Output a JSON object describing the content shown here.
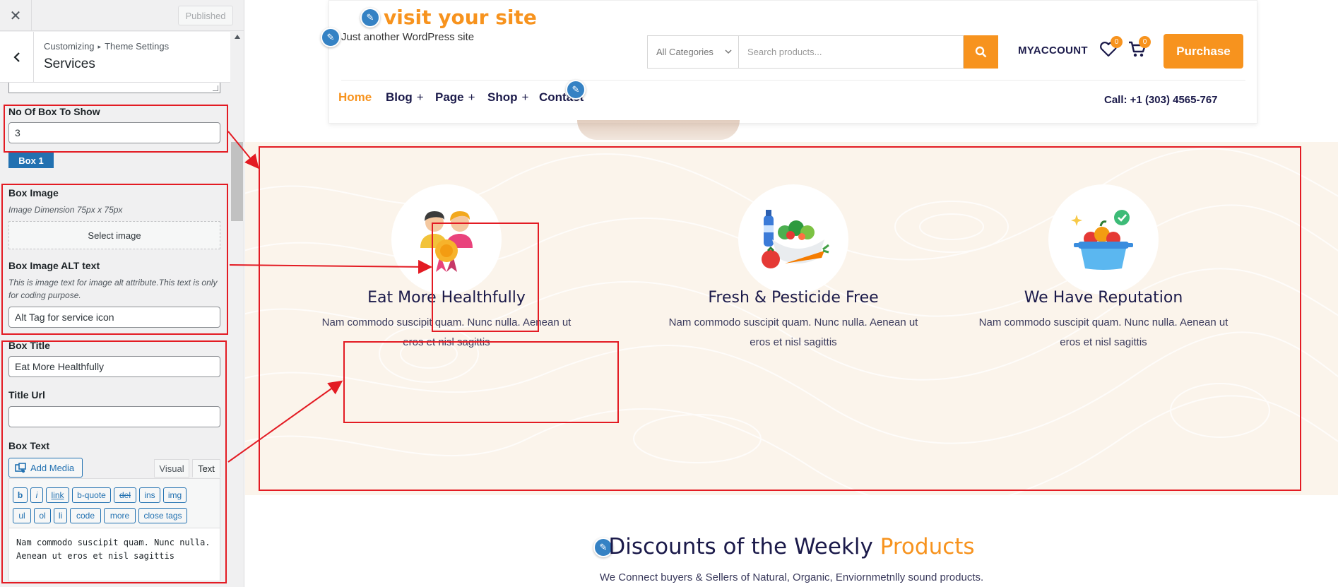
{
  "customizer": {
    "close_label": "✕",
    "published_label": "Published",
    "back_label": "‹",
    "breadcrumb": [
      "Customizing",
      "Theme Settings"
    ],
    "breadcrumb_sep": "▸",
    "section_title": "Services",
    "fields": {
      "no_of_box_label": "No Of Box To Show",
      "no_of_box_value": "3",
      "box_tab_label": "Box 1",
      "box_image_label": "Box Image",
      "box_image_desc": "Image Dimension 75px x 75px",
      "select_image_label": "Select image",
      "alt_label": "Box Image ALT text",
      "alt_desc": "This is image text for image alt attribute.This text is only for coding purpose.",
      "alt_value": "Alt Tag for service icon",
      "box_title_label": "Box Title",
      "box_title_value": "Eat More Healthfully",
      "title_url_label": "Title Url",
      "title_url_value": "",
      "box_text_label": "Box Text",
      "add_media_label": "Add Media",
      "visual_tab": "Visual",
      "text_tab": "Text",
      "quicktags_row1": [
        "b",
        "i",
        "link",
        "b-quote",
        "del",
        "ins",
        "img"
      ],
      "quicktags_row2": [
        "ul",
        "ol",
        "li",
        "code",
        "more",
        "close tags"
      ],
      "box_text_value": "Nam commodo suscipit quam. Nunc nulla. Aenean ut eros et nisl sagittis"
    }
  },
  "site": {
    "title": "visit your site",
    "tagline": "Just another WordPress site",
    "category_select": "All Categories",
    "search_placeholder": "Search products...",
    "myaccount": "MYACCOUNT",
    "wishlist_count": "0",
    "cart_count": "0",
    "purchase_label": "Purchase",
    "nav": [
      {
        "label": "Home",
        "plus": ""
      },
      {
        "label": "Blog",
        "plus": "+"
      },
      {
        "label": "Page",
        "plus": "+"
      },
      {
        "label": "Shop",
        "plus": "+"
      },
      {
        "label": "Contact",
        "plus": ""
      }
    ],
    "call": "Call: +1 (303) 4565-767",
    "accent_color": "#f7931e",
    "heading_color": "#1b1a4a"
  },
  "services": [
    {
      "title": "Eat More Healthfully",
      "text": "Nam commodo suscipit quam. Nunc nulla. Aenean ut eros et nisl sagittis",
      "icon": "award-people-icon"
    },
    {
      "title": "Fresh & Pesticide Free",
      "text": "Nam commodo suscipit quam. Nunc nulla. Aenean ut eros et nisl sagittis",
      "icon": "fresh-vegetables-icon"
    },
    {
      "title": "We Have Reputation",
      "text": "Nam commodo suscipit quam. Nunc nulla. Aenean ut eros et nisl sagittis",
      "icon": "fruit-basket-icon"
    }
  ],
  "discounts": {
    "title_main": "Discounts of the Weekly ",
    "title_accent": "Products",
    "subtitle": "We Connect buyers & Sellers of Natural, Organic, Enviornmetnlly sound products."
  },
  "annotation_color": "#e31b23"
}
